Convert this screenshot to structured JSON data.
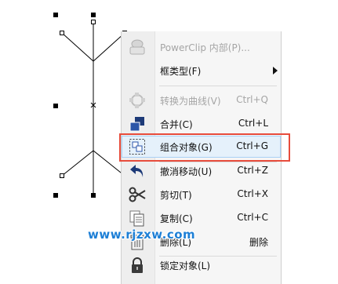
{
  "menu": {
    "items": [
      {
        "label": "PowerClip 内部(P)...",
        "shortcut": "",
        "icon": "powerclip-icon",
        "disabled": true
      },
      {
        "label": "框类型(F)",
        "shortcut": "",
        "icon": "",
        "disabled": false,
        "submenu": true
      },
      {
        "label": "转换为曲线(V)",
        "shortcut": "Ctrl+Q",
        "icon": "convert-to-curves-icon",
        "disabled": true
      },
      {
        "label": "合并(C)",
        "shortcut": "Ctrl+L",
        "icon": "combine-icon",
        "disabled": false
      },
      {
        "label": "组合对象(G)",
        "shortcut": "Ctrl+G",
        "icon": "group-objects-icon",
        "disabled": false,
        "highlighted": true
      },
      {
        "label": "撤消移动(U)",
        "shortcut": "Ctrl+Z",
        "icon": "undo-icon",
        "disabled": false
      },
      {
        "label": "剪切(T)",
        "shortcut": "Ctrl+X",
        "icon": "scissors-icon",
        "disabled": false
      },
      {
        "label": "复制(C)",
        "shortcut": "Ctrl+C",
        "icon": "copy-icon",
        "disabled": false
      },
      {
        "label": "删除(L)",
        "shortcut": "删除",
        "icon": "delete-icon",
        "disabled": false
      },
      {
        "label": "锁定对象(L)",
        "shortcut": "",
        "icon": "lock-icon",
        "disabled": false
      }
    ]
  },
  "watermark": "www.rjzxw.com",
  "colors": {
    "highlight": "#e5f1fb",
    "annotation": "#e74c3c",
    "watermark": "#1d7fd6"
  }
}
